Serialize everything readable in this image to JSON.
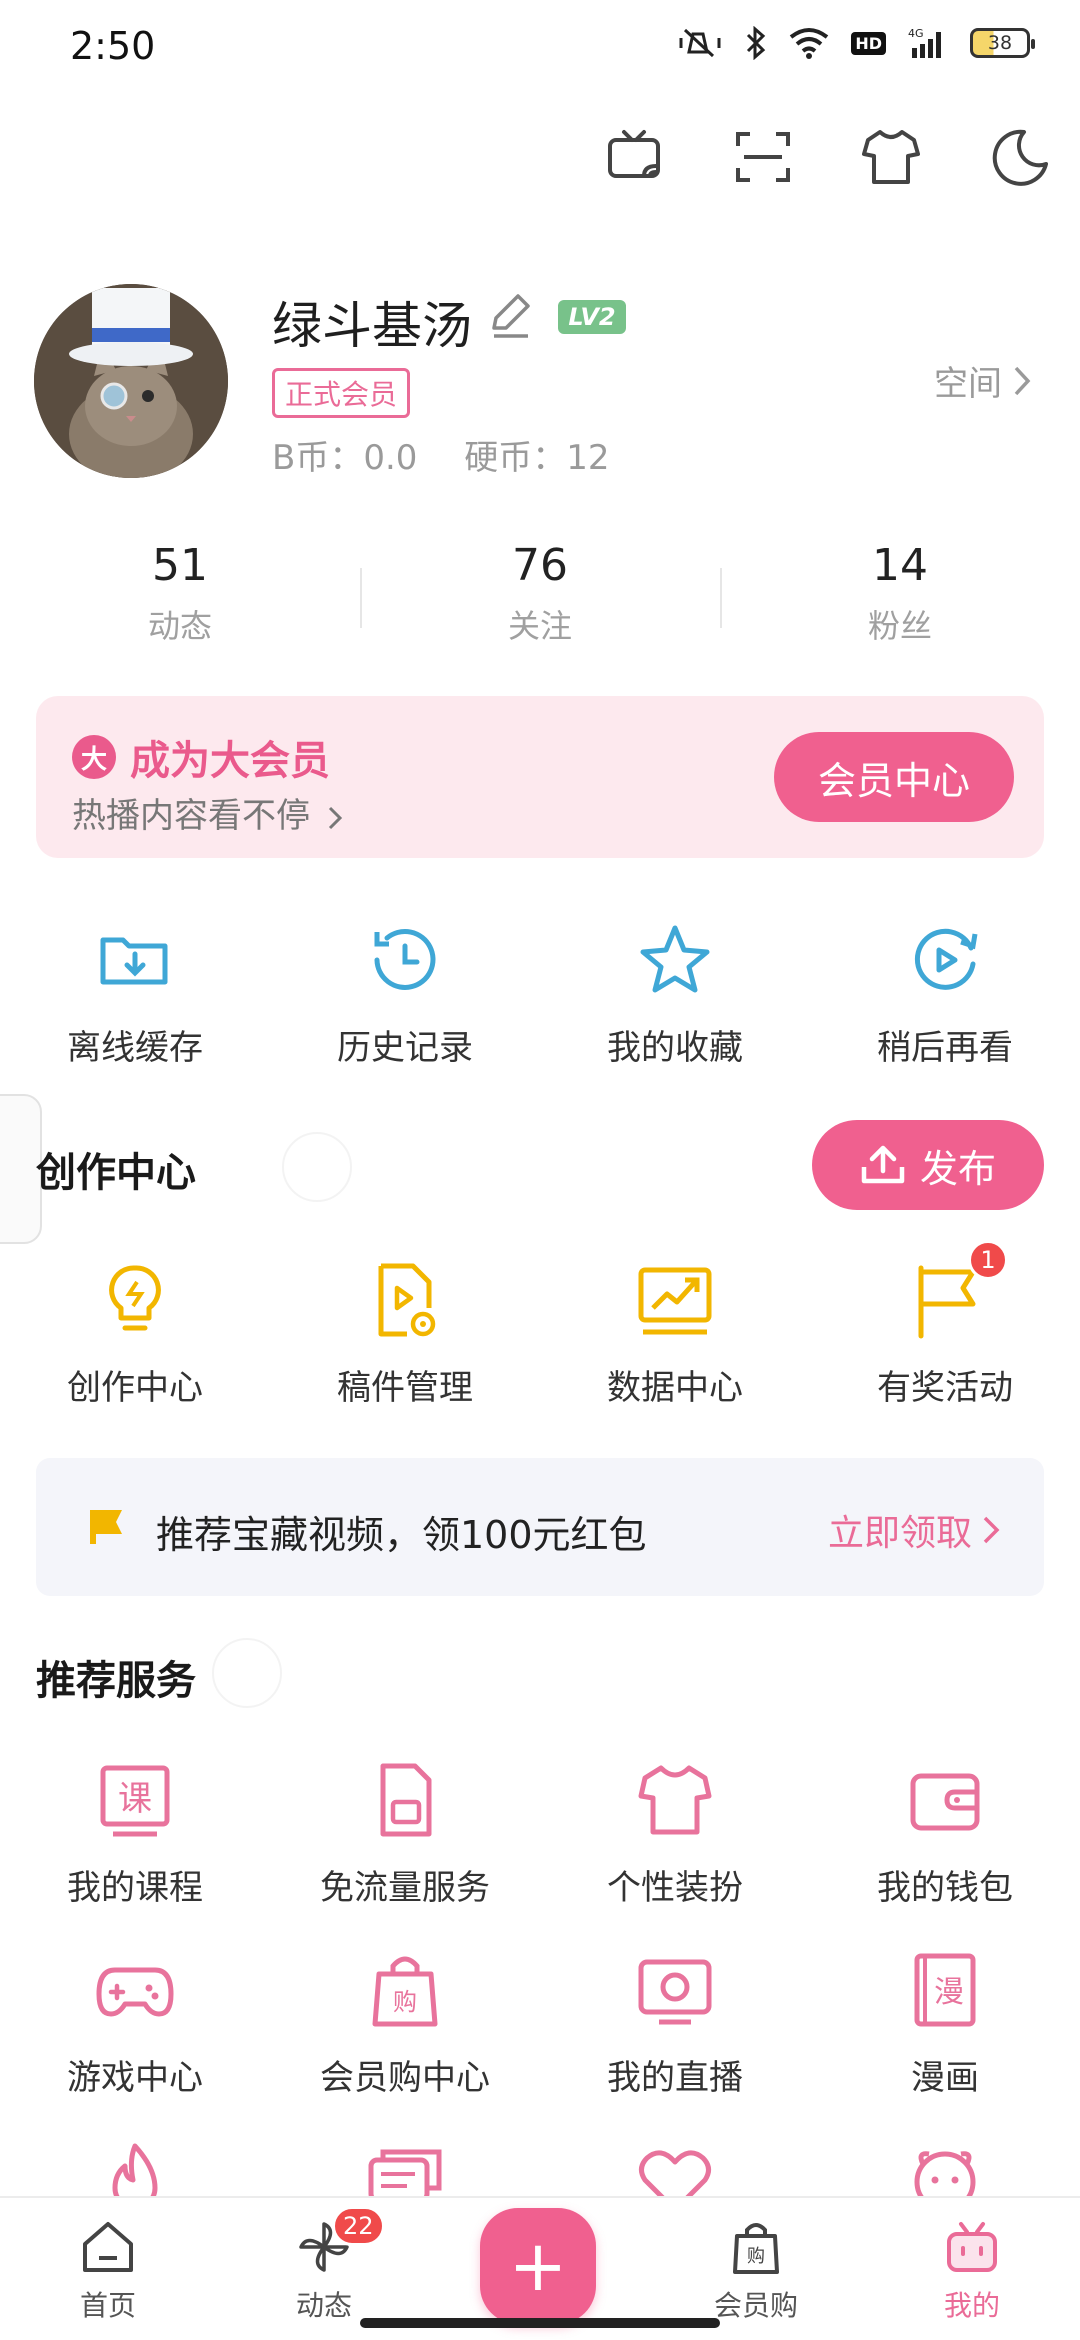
{
  "status_bar": {
    "time": "2:50",
    "battery": "38",
    "network_label": "4G",
    "hd_label": "HD"
  },
  "top_actions": [
    {
      "name": "cast-icon"
    },
    {
      "name": "scan-icon"
    },
    {
      "name": "skin-shirt-icon"
    },
    {
      "name": "night-mode-icon"
    }
  ],
  "profile": {
    "username": "绿斗基汤",
    "level": "LV2",
    "member_tag": "正式会员",
    "space_link": "空间",
    "b_coin": "B币：0.0",
    "coin": "硬币：12"
  },
  "stats": [
    {
      "value": "51",
      "label": "动态"
    },
    {
      "value": "76",
      "label": "关注"
    },
    {
      "value": "14",
      "label": "粉丝"
    }
  ],
  "vip": {
    "badge": "大",
    "title": "成为大会员",
    "subtitle": "热播内容看不停",
    "button": "会员中心",
    "color": "#F0608F"
  },
  "quick_actions": [
    {
      "label": "离线缓存",
      "icon": "offline-cache-icon"
    },
    {
      "label": "历史记录",
      "icon": "history-icon"
    },
    {
      "label": "我的收藏",
      "icon": "star-icon"
    },
    {
      "label": "稍后再看",
      "icon": "watch-later-icon"
    }
  ],
  "creation": {
    "title": "创作中心",
    "publish_button": "发布",
    "items": [
      {
        "label": "创作中心",
        "icon": "lightbulb-icon"
      },
      {
        "label": "稿件管理",
        "icon": "manuscript-icon"
      },
      {
        "label": "数据中心",
        "icon": "data-chart-icon"
      },
      {
        "label": "有奖活动",
        "icon": "flag-icon",
        "badge": "1"
      }
    ]
  },
  "reward_banner": {
    "text": "推荐宝藏视频，领100元红包",
    "link": "立即领取"
  },
  "services": {
    "title": "推荐服务",
    "row1": [
      {
        "label": "我的课程",
        "icon": "course-icon"
      },
      {
        "label": "免流量服务",
        "icon": "sim-card-icon"
      },
      {
        "label": "个性装扮",
        "icon": "shirt-icon"
      },
      {
        "label": "我的钱包",
        "icon": "wallet-icon"
      }
    ],
    "row2": [
      {
        "label": "游戏中心",
        "icon": "gamepad-icon"
      },
      {
        "label": "会员购中心",
        "icon": "shopping-bag-icon"
      },
      {
        "label": "我的直播",
        "icon": "live-tv-icon"
      },
      {
        "label": "漫画",
        "icon": "comic-book-icon"
      }
    ],
    "row3": [
      {
        "icon": "fire-icon"
      },
      {
        "icon": "chat-icon"
      },
      {
        "icon": "heart-icon"
      },
      {
        "icon": "mascot-icon"
      }
    ]
  },
  "bottom_nav": {
    "home": "首页",
    "dynamic": "动态",
    "dynamic_badge": "22",
    "shop": "会员购",
    "mine": "我的",
    "plus": "+"
  },
  "colors": {
    "accent": "#F0608F",
    "blue_icon": "#3FA7D6",
    "yellow_icon": "#F2B600",
    "pink_icon": "#E8739C"
  }
}
